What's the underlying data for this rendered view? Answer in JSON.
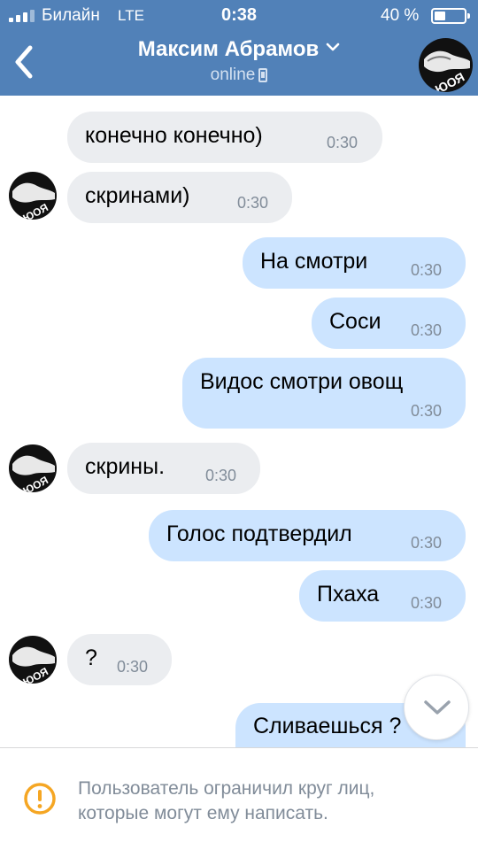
{
  "status_bar": {
    "carrier": "Билайн",
    "network": "LTE",
    "time": "0:38",
    "battery_percent": "40 %",
    "battery_level": 0.4
  },
  "header": {
    "title": "Максим Абрамов",
    "subtitle": "online",
    "back_icon": "chevron-left-icon",
    "title_dropdown_icon": "chevron-down-icon",
    "device_icon": "phone-icon"
  },
  "messages": [
    {
      "dir": "in",
      "text": "конечно конечно)",
      "time": "0:30"
    },
    {
      "dir": "in",
      "text": "скринами)",
      "time": "0:30"
    },
    {
      "dir": "out",
      "text": "На смотри",
      "time": "0:30"
    },
    {
      "dir": "out",
      "text": "Соси",
      "time": "0:30"
    },
    {
      "dir": "out",
      "text": "Видос смотри овощ",
      "time": "0:30"
    },
    {
      "dir": "in",
      "text": "скрины.",
      "time": "0:30"
    },
    {
      "dir": "out",
      "text": "Голос подтвердил",
      "time": "0:30"
    },
    {
      "dir": "out",
      "text": "Пхаха",
      "time": "0:30"
    },
    {
      "dir": "in",
      "text": "?",
      "time": "0:30"
    },
    {
      "dir": "out",
      "text": "Сливаешься ?",
      "time": ""
    }
  ],
  "scroll_down_icon": "chevron-down-icon",
  "footer": {
    "icon": "warning-circle-icon",
    "line1": "Пользователь ограничил круг лиц,",
    "line2": "которые могут ему написать."
  },
  "colors": {
    "header_bg": "#5181b8",
    "incoming_bubble": "#ebedf0",
    "outgoing_bubble": "#cce4ff",
    "time_text": "#818c99",
    "warning": "#f5a623"
  }
}
